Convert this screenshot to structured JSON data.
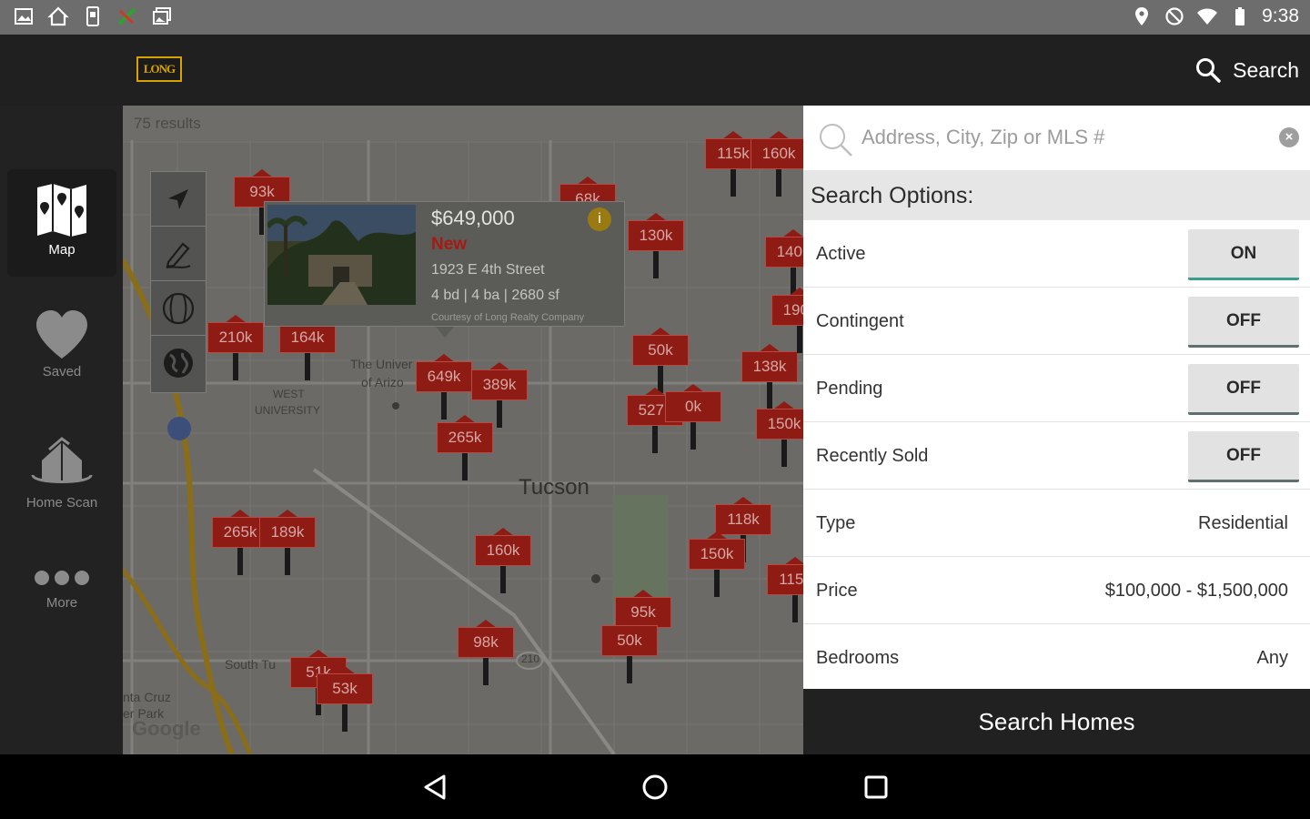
{
  "status_bar": {
    "time": "9:38",
    "left_icons": [
      "image-icon",
      "home-icon",
      "phone-icon",
      "app-icon",
      "photo-stack-icon"
    ],
    "right_icons": [
      "location-icon",
      "blocked-icon",
      "wifi-icon",
      "battery-icon"
    ]
  },
  "app_bar": {
    "logo_text": "LONG",
    "search_label": "Search"
  },
  "rail": {
    "items": [
      {
        "label": "Map",
        "icon": "map-icon",
        "active": true
      },
      {
        "label": "Saved",
        "icon": "heart-icon",
        "active": false
      },
      {
        "label": "Home Scan",
        "icon": "house-scan-icon",
        "active": false
      },
      {
        "label": "More",
        "icon": "more-dots-icon",
        "active": false
      }
    ]
  },
  "map": {
    "results_count": "75 results",
    "city_label": "Tucson",
    "google_label": "Google",
    "labels": {
      "university": "The Univer",
      "of_arizona": "of Arizo",
      "west": "WEST",
      "university_district": "UNIVERSITY",
      "south_tucson": "South Tu",
      "santa_cruz": "nta Cruz",
      "park": "er Park",
      "route": "210"
    },
    "tools": [
      "locate-icon",
      "draw-icon",
      "boundary-icon",
      "globe-icon"
    ],
    "pins": [
      {
        "label": "93k"
      },
      {
        "label": "210k"
      },
      {
        "label": "164k"
      },
      {
        "label": "649k"
      },
      {
        "label": "389k"
      },
      {
        "label": "265k"
      },
      {
        "label": "265k"
      },
      {
        "label": "189k"
      },
      {
        "label": "160k"
      },
      {
        "label": "98k"
      },
      {
        "label": "51k"
      },
      {
        "label": "53k"
      },
      {
        "label": "115k"
      },
      {
        "label": "130k"
      },
      {
        "label": "50k"
      },
      {
        "label": "527k"
      },
      {
        "label": "0k"
      },
      {
        "label": "138k"
      },
      {
        "label": "150k"
      },
      {
        "label": "118k"
      },
      {
        "label": "150k"
      },
      {
        "label": "95k"
      },
      {
        "label": "50k"
      },
      {
        "label": "140k"
      },
      {
        "label": "190k"
      },
      {
        "label": "115k"
      },
      {
        "label": "160k"
      },
      {
        "label": "68k"
      }
    ]
  },
  "popup": {
    "price": "$649,000",
    "status": "New",
    "address": "1923 E 4th Street",
    "specs": "4 bd | 4 ba | 2680 sf",
    "courtesy": "Courtesy of Long Realty Company"
  },
  "search_panel": {
    "placeholder": "Address, City, Zip or MLS #",
    "options_title": "Search Options:",
    "toggles": [
      {
        "label": "Active",
        "state": "ON"
      },
      {
        "label": "Contingent",
        "state": "OFF"
      },
      {
        "label": "Pending",
        "state": "OFF"
      },
      {
        "label": "Recently Sold",
        "state": "OFF"
      }
    ],
    "fields": [
      {
        "label": "Type",
        "value": "Residential"
      },
      {
        "label": "Price",
        "value": "$100,000 - $1,500,000"
      },
      {
        "label": "Bedrooms",
        "value": "Any"
      }
    ],
    "submit_label": "Search Homes"
  },
  "nav_bar": {
    "buttons": [
      "back-icon",
      "home-circle-icon",
      "recents-icon"
    ]
  },
  "colors": {
    "pin_red": "#8e1b14",
    "toggle_on_accent": "#3b9d8e",
    "popup_status_red": "#a61a12",
    "logo_gold": "#d8a200"
  }
}
